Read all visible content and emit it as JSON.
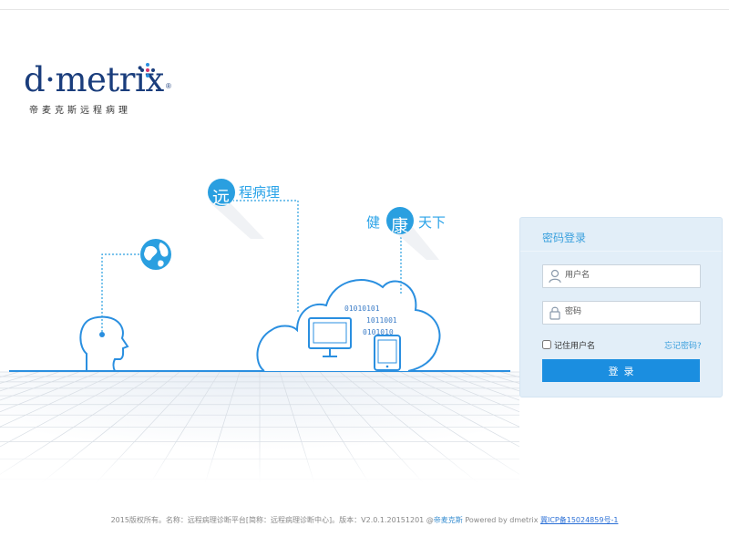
{
  "logo": {
    "wordmark": "d·metrix",
    "registered": "®",
    "subtitle": "帝麦克斯远程病理"
  },
  "illustration": {
    "bubble1_char": "远",
    "bubble1_text": "程病理",
    "bubble2_left": "健",
    "bubble2_char": "康",
    "bubble2_text": "天下",
    "binary_lines": [
      "01010101",
      "1011001",
      "0101010"
    ]
  },
  "login": {
    "title": "密码登录",
    "username_placeholder": "用户名",
    "password_placeholder": "密码",
    "remember_label": "记住用户名",
    "forgot_label": "忘记密码?",
    "submit_label": "登录"
  },
  "footer": {
    "text": "2015版权所有。名称：远程病理诊断平台[简称：远程病理诊断中心]。版本：V2.0.1.20151201 @",
    "brand": "帝麦克斯",
    "powered": " Powered by dmetrix ",
    "icp": "冀ICP备15024859号-1"
  },
  "colors": {
    "accent": "#1b8ee0",
    "brand_navy": "#1a3d7c",
    "panel_bg": "#e2eef8",
    "line_blue": "#2a8fe0"
  }
}
